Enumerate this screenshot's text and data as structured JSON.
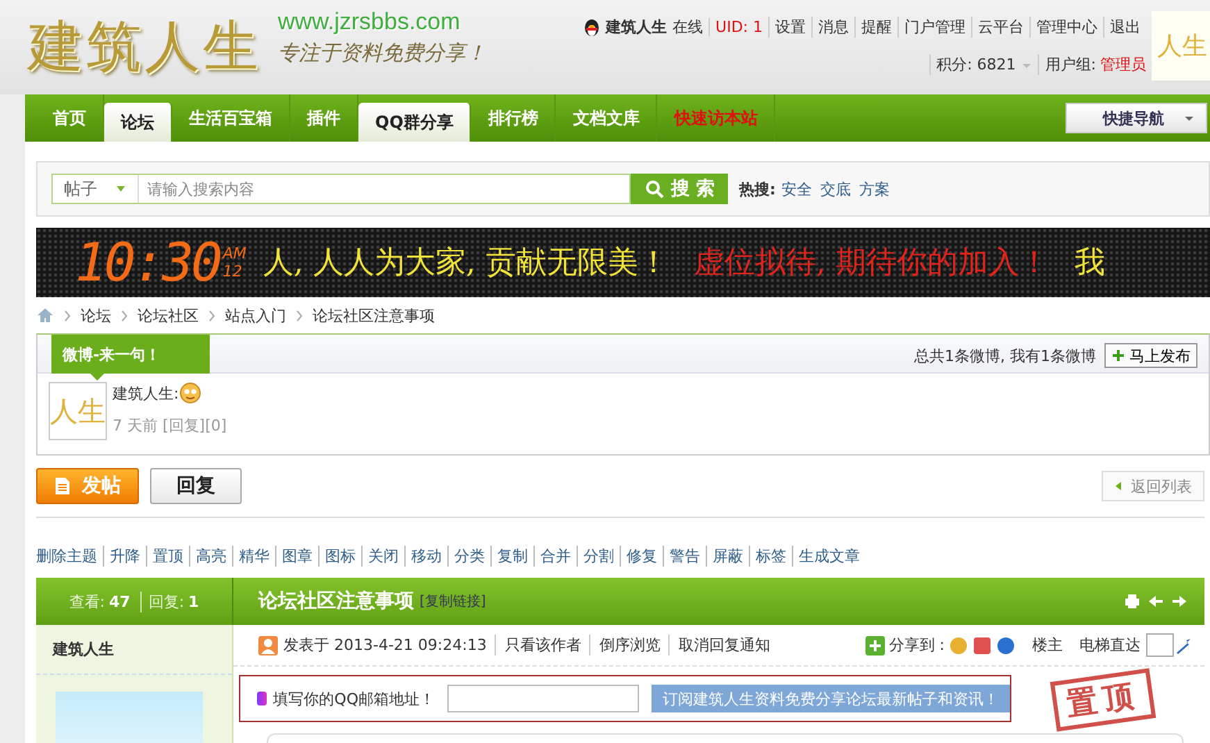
{
  "header": {
    "logo": "建筑人生",
    "site_url": "www.jzrsbbs.com",
    "slogan": "专注于资料免费分享！",
    "user": {
      "name": "建筑人生",
      "status": "在线",
      "uid": "UID: 1",
      "links": [
        "设置",
        "消息",
        "提醒",
        "门户管理",
        "云平台",
        "管理中心",
        "退出"
      ],
      "points": "积分: 6821",
      "group_label": "用户组:",
      "group": "管理员",
      "avatar_text": "人生"
    }
  },
  "nav": {
    "tabs": [
      {
        "label": "首页",
        "selected": false,
        "highlight": false
      },
      {
        "label": "论坛",
        "selected": true,
        "highlight": false
      },
      {
        "label": "生活百宝箱",
        "selected": false,
        "highlight": false
      },
      {
        "label": "插件",
        "selected": false,
        "highlight": false
      },
      {
        "label": "QQ群分享",
        "selected": true,
        "highlight": false
      },
      {
        "label": "排行榜",
        "selected": false,
        "highlight": false
      },
      {
        "label": "文档文库",
        "selected": false,
        "highlight": false
      },
      {
        "label": "快速访本站",
        "selected": false,
        "highlight": true
      }
    ],
    "quick_nav": "快捷导航"
  },
  "search": {
    "scope": "帖子",
    "placeholder": "请输入搜索内容",
    "button": "搜 索",
    "hot_label": "热搜:",
    "hot": [
      "安全",
      "交底",
      "方案"
    ]
  },
  "banner": {
    "clock": "10:30",
    "ampm": "AM",
    "seconds": "12",
    "messages": [
      {
        "text": "人, 人人为大家, 贡献无限美！",
        "color": "#f2e33a"
      },
      {
        "text": "虚位拟待, 期待你的加入！",
        "color": "#e0241c"
      },
      {
        "text": "我",
        "color": "#f2e33a"
      }
    ]
  },
  "breadcrumb": [
    "论坛",
    "论坛社区",
    "站点入门",
    "论坛社区注意事项"
  ],
  "weibo": {
    "tab": "微博-来一句！",
    "summary": "总共1条微博, 我有1条微博",
    "publish": "马上发布",
    "post": {
      "avatar_text": "人生",
      "author": "建筑人生:",
      "meta": "7 天前 [回复][0]"
    }
  },
  "actions": {
    "new_post": "发帖",
    "reply": "回复",
    "back": "返回列表"
  },
  "mod_tools": [
    "删除主题",
    "升降",
    "置顶",
    "高亮",
    "精华",
    "图章",
    "图标",
    "关闭",
    "移动",
    "分类",
    "复制",
    "合并",
    "分割",
    "修复",
    "警告",
    "屏蔽",
    "标签",
    "生成文章"
  ],
  "thread": {
    "views_label": "查看:",
    "views": "47",
    "replies_label": "回复:",
    "replies": "1",
    "title": "论坛社区注意事项",
    "copy_link": "[复制链接]",
    "author": "建筑人生",
    "posted": "发表于 2013-4-21 09:24:13",
    "post_links": [
      "只看该作者",
      "倒序浏览",
      "取消回复通知"
    ],
    "stamp": "置顶",
    "share_label": "分享到 :",
    "floor": "楼主",
    "jump_label": "电梯直达",
    "subscribe": {
      "label": "填写你的QQ邮箱地址！",
      "button": "订阅建筑人生资料免费分享论坛最新帖子和资讯！"
    }
  }
}
